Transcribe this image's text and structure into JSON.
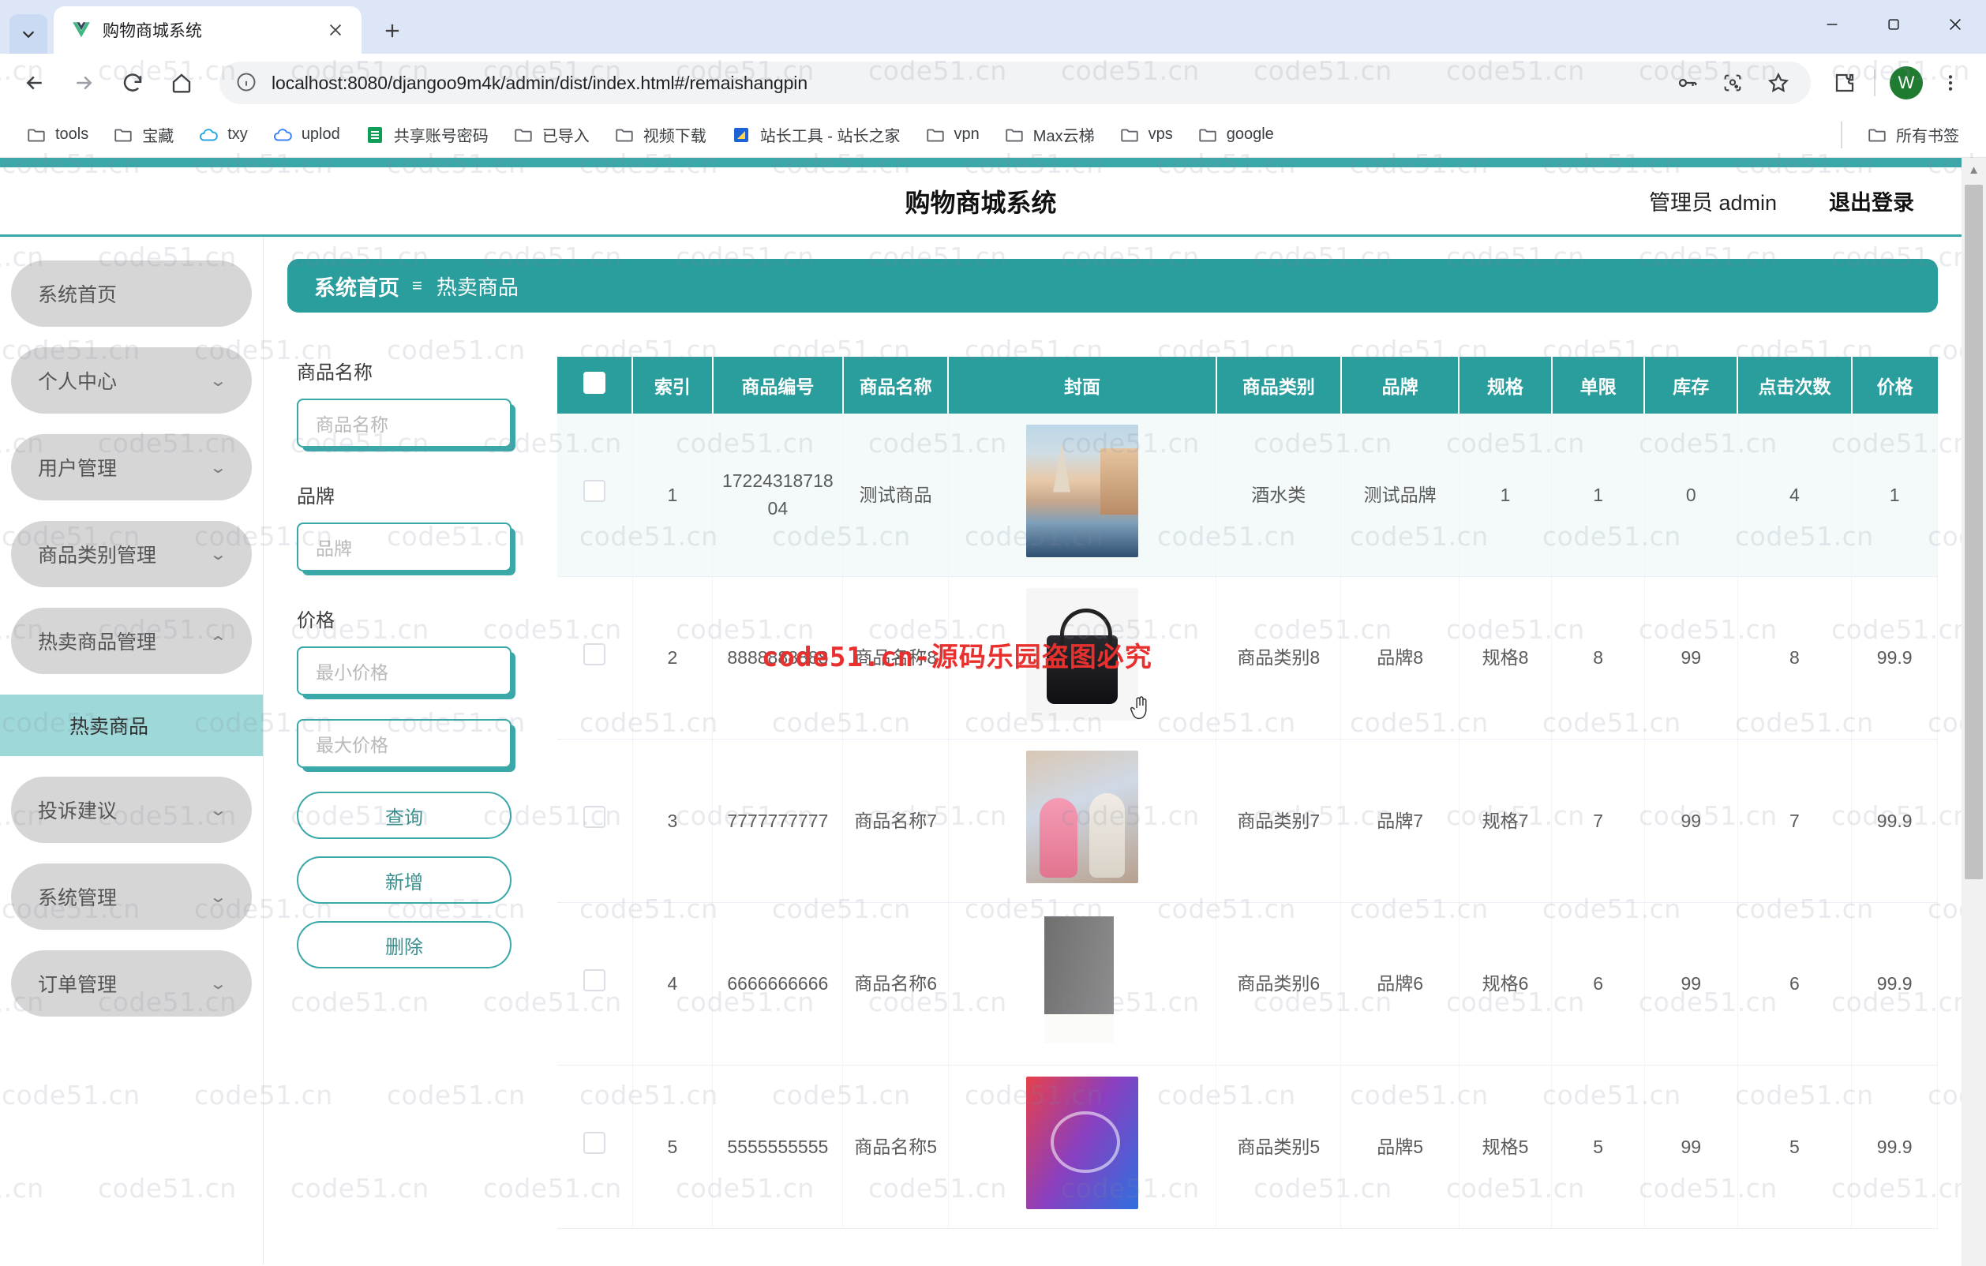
{
  "browser": {
    "tab": {
      "title": "购物商城系统",
      "favicon_icon": "vue-logo-icon",
      "close_icon": "close-icon"
    },
    "tab_list_icon": "chevron-down-icon",
    "new_tab_icon": "plus-icon",
    "window_controls": {
      "minimize": "minimize-icon",
      "maximize": "maximize-icon",
      "close": "close-icon"
    },
    "nav": {
      "back_icon": "back-arrow-icon",
      "forward_icon": "forward-arrow-icon",
      "reload_icon": "reload-icon",
      "home_icon": "home-icon"
    },
    "omnibox": {
      "info_icon": "site-info-icon",
      "url": "localhost:8080/djangoo9m4k/admin/dist/index.html#/remaishangpin",
      "actions": [
        "password-key-icon",
        "lens-camera-icon",
        "bookmark-star-icon"
      ]
    },
    "toolbar_right": {
      "extensions_icon": "extensions-puzzle-icon",
      "avatar_letter": "W",
      "menu_icon": "three-dot-menu-icon"
    },
    "bookmarks": [
      {
        "label": "tools",
        "icon": "folder-icon"
      },
      {
        "label": "宝藏",
        "icon": "folder-icon"
      },
      {
        "label": "txy",
        "icon": "cloud-blue-icon"
      },
      {
        "label": "uplod",
        "icon": "cloud-blue-icon"
      },
      {
        "label": "共享账号密码",
        "icon": "sheets-green-icon"
      },
      {
        "label": "已导入",
        "icon": "folder-icon"
      },
      {
        "label": "视频下载",
        "icon": "folder-icon"
      },
      {
        "label": "站长工具 - 站长之家",
        "icon": "site-tool-icon"
      },
      {
        "label": "vpn",
        "icon": "folder-icon"
      },
      {
        "label": "Max云梯",
        "icon": "folder-icon"
      },
      {
        "label": "vps",
        "icon": "folder-icon"
      },
      {
        "label": "google",
        "icon": "folder-icon"
      }
    ],
    "all_bookmarks": {
      "label": "所有书签",
      "icon": "folder-icon"
    }
  },
  "app": {
    "title": "购物商城系统",
    "admin_label": "管理员 admin",
    "logout_label": "退出登录",
    "accent_color": "#2a9d9d",
    "accent_light": "#3aa8a8"
  },
  "sidebar": {
    "items": [
      {
        "label": "系统首页",
        "expandable": false
      },
      {
        "label": "个人中心",
        "expandable": true,
        "chevron": "chevron-down-icon"
      },
      {
        "label": "用户管理",
        "expandable": true,
        "chevron": "chevron-down-icon"
      },
      {
        "label": "商品类别管理",
        "expandable": true,
        "chevron": "chevron-down-icon"
      },
      {
        "label": "热卖商品管理",
        "expandable": true,
        "expanded": true,
        "chevron": "chevron-up-icon"
      },
      {
        "label": "投诉建议",
        "expandable": true,
        "chevron": "chevron-down-icon"
      },
      {
        "label": "系统管理",
        "expandable": true,
        "chevron": "chevron-down-icon"
      },
      {
        "label": "订单管理",
        "expandable": true,
        "chevron": "chevron-down-icon"
      }
    ],
    "submenu": {
      "label": "热卖商品",
      "active": true
    }
  },
  "breadcrumb": {
    "home": "系统首页",
    "separator_icon": "menu-bars-icon",
    "current": "热卖商品"
  },
  "filters": {
    "name_label": "商品名称",
    "name_placeholder": "商品名称",
    "name_value": "",
    "brand_label": "品牌",
    "brand_placeholder": "品牌",
    "brand_value": "",
    "price_label": "价格",
    "price_min_placeholder": "最小价格",
    "price_min_value": "",
    "price_max_placeholder": "最大价格",
    "price_max_value": "",
    "search_button": "查询",
    "add_button": "新增",
    "delete_button": "删除"
  },
  "table": {
    "select_all_icon": "checkbox-icon",
    "columns": [
      "索引",
      "商品编号",
      "商品名称",
      "封面",
      "商品类别",
      "品牌",
      "规格",
      "单限",
      "库存",
      "点击次数",
      "价格"
    ],
    "rows": [
      {
        "index": "1",
        "code": "1722431871804",
        "name": "测试商品",
        "cover_icon": "venice-canal-photo",
        "category": "酒水类",
        "brand": "测试品牌",
        "spec": "1",
        "limit": "1",
        "stock": "0",
        "clicks": "4",
        "price": "1"
      },
      {
        "index": "2",
        "code": "8888888888",
        "name": "商品名称8",
        "cover_icon": "black-handbag-photo",
        "category": "商品类别8",
        "brand": "品牌8",
        "spec": "规格8",
        "limit": "8",
        "stock": "99",
        "clicks": "8",
        "price": "99.9"
      },
      {
        "index": "3",
        "code": "7777777777",
        "name": "商品名称7",
        "cover_icon": "plush-toys-photo",
        "category": "商品类别7",
        "brand": "品牌7",
        "spec": "规格7",
        "limit": "7",
        "stock": "99",
        "clicks": "7",
        "price": "99.9"
      },
      {
        "index": "4",
        "code": "6666666666",
        "name": "商品名称6",
        "cover_icon": "grey-book-photo",
        "category": "商品类别6",
        "brand": "品牌6",
        "spec": "规格6",
        "limit": "6",
        "stock": "99",
        "clicks": "6",
        "price": "99.9"
      },
      {
        "index": "5",
        "code": "5555555555",
        "name": "商品名称5",
        "cover_icon": "earbuds-gradient-photo",
        "category": "商品类别5",
        "brand": "品牌5",
        "spec": "规格5",
        "limit": "5",
        "stock": "99",
        "clicks": "5",
        "price": "99.9"
      }
    ]
  },
  "watermarks": {
    "tile_text": "code51.cn",
    "red_notice": "code51.cn-源码乐园盗图必究",
    "red_color": "#e8312f"
  },
  "scrollbar": {
    "up_arrow_icon": "scroll-up-arrow-icon",
    "position": "top"
  },
  "cursor": {
    "icon": "pointing-hand-cursor"
  }
}
